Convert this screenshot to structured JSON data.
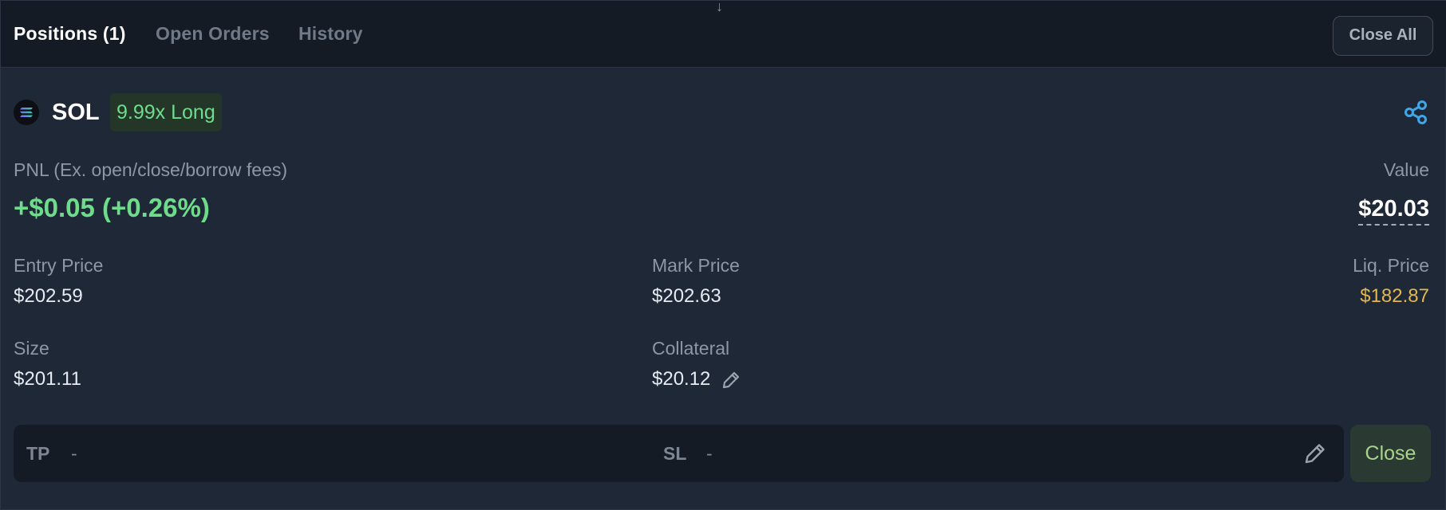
{
  "header": {
    "tabs": [
      {
        "label": "Positions (1)"
      },
      {
        "label": "Open Orders"
      },
      {
        "label": "History"
      }
    ],
    "close_all_label": "Close All"
  },
  "position": {
    "asset": "SOL",
    "asset_icon": "solana-logo-icon",
    "side_badge": "9.99x Long",
    "pnl_label": "PNL (Ex. open/close/borrow fees)",
    "pnl_value": "+$0.05 (+0.26%)",
    "value_label": "Value",
    "value_amount": "$20.03",
    "entry_price_label": "Entry Price",
    "entry_price": "$202.59",
    "mark_price_label": "Mark Price",
    "mark_price": "$202.63",
    "liq_price_label": "Liq. Price",
    "liq_price": "$182.87",
    "size_label": "Size",
    "size": "$201.11",
    "collateral_label": "Collateral",
    "collateral": "$20.12",
    "tp_label": "TP",
    "tp_value": "-",
    "sl_label": "SL",
    "sl_value": "-",
    "close_label": "Close"
  },
  "colors": {
    "positive": "#6fdc8c",
    "liquidation": "#e3b74f",
    "accent_share": "#3fa6ea"
  }
}
